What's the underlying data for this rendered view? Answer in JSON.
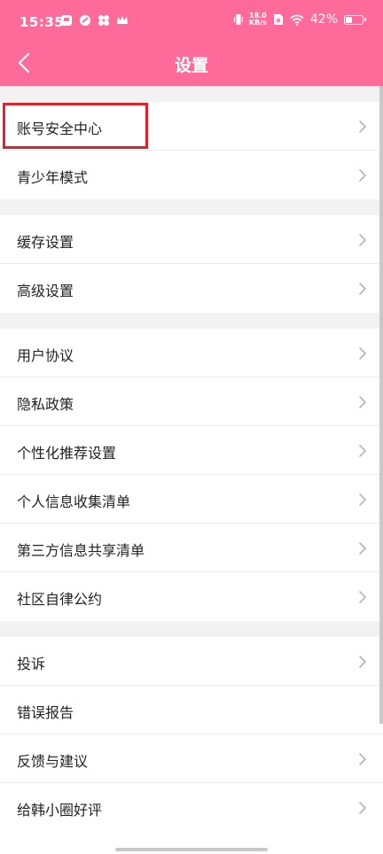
{
  "status_bar": {
    "time": "15:35",
    "net_speed_value": "18.0",
    "net_speed_unit": "KB/s",
    "battery_percent": "42%",
    "battery_level": 0.42
  },
  "nav": {
    "title": "设置"
  },
  "groups": [
    {
      "items": [
        {
          "label": "账号安全中心",
          "has_chevron": true,
          "highlighted": true
        },
        {
          "label": "青少年模式",
          "has_chevron": true
        }
      ]
    },
    {
      "items": [
        {
          "label": "缓存设置",
          "has_chevron": true
        },
        {
          "label": "高级设置",
          "has_chevron": true
        }
      ]
    },
    {
      "items": [
        {
          "label": "用户协议",
          "has_chevron": true
        },
        {
          "label": "隐私政策",
          "has_chevron": true
        },
        {
          "label": "个性化推荐设置",
          "has_chevron": true
        },
        {
          "label": "个人信息收集清单",
          "has_chevron": true
        },
        {
          "label": "第三方信息共享清单",
          "has_chevron": true
        },
        {
          "label": "社区自律公约",
          "has_chevron": true
        }
      ]
    },
    {
      "items": [
        {
          "label": "投诉",
          "has_chevron": true
        },
        {
          "label": "错误报告",
          "has_chevron": false
        },
        {
          "label": "反馈与建议",
          "has_chevron": true
        },
        {
          "label": "给韩小圈好评",
          "has_chevron": true
        }
      ]
    }
  ],
  "colors": {
    "header_bg": "#fe6b9b",
    "highlight_border": "#e0202a",
    "separator_bg": "#f2f2f2",
    "chevron": "#b5b5b5"
  },
  "icons": {
    "back": "chevron-left-icon",
    "item_arrow": "chevron-right-icon"
  }
}
